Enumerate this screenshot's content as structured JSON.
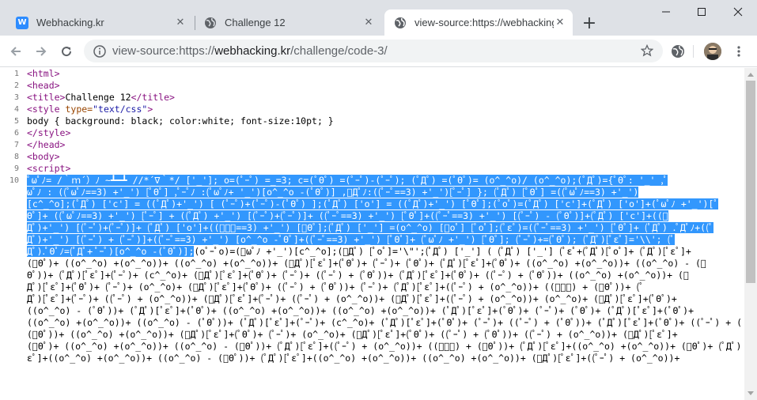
{
  "browser": {
    "tabs": [
      {
        "title": "Webhacking.kr",
        "favicon": "w-logo-icon",
        "active": false
      },
      {
        "title": "Challenge 12",
        "favicon": "globe-icon",
        "active": false
      },
      {
        "title": "view-source:https://webhacking",
        "favicon": "globe-icon",
        "active": true
      }
    ],
    "close_glyph": "✕",
    "new_tab_glyph": "+",
    "address": {
      "scheme": "view-source:https://",
      "host": "webhacking.kr",
      "path": "/challenge/code-3/"
    }
  },
  "source": {
    "lines": [
      {
        "num": "1",
        "open": "<html>"
      },
      {
        "num": "2",
        "open": "<head>"
      },
      {
        "num": "3",
        "open": "<title>",
        "text": "Challenge 12",
        "close": "</title>"
      },
      {
        "num": "4",
        "tagstart": "<style ",
        "attrname": "type=",
        "attrval": "\"text/css\"",
        "tagend": ">"
      },
      {
        "num": "5",
        "text": "body { background: black; color:white; font-size:10pt; }"
      },
      {
        "num": "6",
        "open": "</style>"
      },
      {
        "num": "7",
        "open": "</head>"
      },
      {
        "num": "8",
        "open": "<body>"
      },
      {
        "num": "9",
        "open": "<script>"
      },
      {
        "num": "10"
      }
    ],
    "line10_wrapped": [
      {
        "sel": "ﾟωﾟﾉ= /｀ｍ´）ﾉ ~┻━┻   //*´∇｀*/ ['_']; o=(ﾟｰﾟ)  =_=3; c=(ﾟΘﾟ) =(ﾟｰﾟ)-(ﾟｰﾟ); (ﾟДﾟ) =(ﾟΘﾟ)= (o^_^o)/ (o^_^o);(ﾟДﾟ)={ﾟΘﾟ: '_' ,ﾟ",
        "rest": ""
      },
      {
        "sel": "ωﾟﾉ : ((ﾟωﾟﾉ==3) +'_') [ﾟΘﾟ] ,ﾟｰﾟﾉ :(ﾟωﾟﾉ+ '_')[o^_^o -(ﾟΘﾟ)] ,ﾟДﾟﾉ:((ﾟｰﾟ==3) +'_')[ﾟｰﾟ] }; (ﾟДﾟ) [ﾟΘﾟ] =((ﾟωﾟﾉ==3) +'_')",
        "rest": ""
      },
      {
        "sel": "[c^_^o];(ﾟДﾟ) ['c'] = ((ﾟДﾟ)+'_') [ (ﾟｰﾟ)+(ﾟｰﾟ)-(ﾟΘﾟ) ];(ﾟДﾟ) ['o'] = ((ﾟДﾟ)+'_') [ﾟΘﾟ];(ﾟoﾟ)=(ﾟДﾟ) ['c']+(ﾟДﾟ) ['o']+(ﾟωﾟﾉ +'_')[ﾟ",
        "rest": ""
      },
      {
        "sel": "Θﾟ]+ ((ﾟωﾟﾉ==3) +'_') [ﾟｰﾟ] + ((ﾟДﾟ) +'_') [(ﾟｰﾟ)+(ﾟｰﾟ)]+ ((ﾟｰﾟ==3) +'_') [ﾟΘﾟ]+((ﾟｰﾟ==3) +'_') [(ﾟｰﾟ) - (ﾟΘﾟ)]+(ﾟДﾟ) ['c']+((ﾟ",
        "rest": ""
      },
      {
        "sel": "Дﾟ)+'_') [(ﾟｰﾟ)+(ﾟｰﾟ)]+ (ﾟДﾟ) ['o']+((ﾟｰﾟ==3) +'_') [ﾟΘﾟ];(ﾟДﾟ) ['_'] =(o^_^o) [ﾟoﾟ] [ﾟoﾟ];(ﾟεﾟ)=((ﾟｰﾟ==3) +'_') [ﾟΘﾟ]+ (ﾟДﾟ) .ﾟДﾟﾉ+((ﾟ",
        "rest": ""
      },
      {
        "sel": "Дﾟ)+'_') [(ﾟｰﾟ) + (ﾟｰﾟ)]+((ﾟｰﾟ==3) +'_') [o^_^o -ﾟΘﾟ]+((ﾟｰﾟ==3) +'_') [ﾟΘﾟ]+ (ﾟωﾟﾉ +'_') [ﾟΘﾟ]; (ﾟｰﾟ)+=(ﾟΘﾟ); (ﾟДﾟ)[ﾟεﾟ]='\\\\'; (ﾟ",
        "rest": ""
      },
      {
        "sel": "Дﾟ).ﾟΘﾟﾉ=(ﾟДﾟ+ ﾟｰﾟ)[o^_^o -(ﾟΘﾟ)];",
        "rest": "(oﾟｰﾟo)=(ﾟωﾟﾉ +'_')[c^_^o];(ﾟДﾟ) [ﾟoﾟ]='\\\"';(ﾟДﾟ) ['_'] ( (ﾟДﾟ) ['_'] (ﾟεﾟ+(ﾟДﾟ)[ﾟoﾟ]+ (ﾟДﾟ)[ﾟεﾟ]+"
      },
      {
        "sel": "",
        "rest": "(ﾟΘﾟ)+ ((o^_^o) +(o^_^o))+ ((o^_^o) +(o^_^o))+ (ﾟДﾟ)[ﾟεﾟ]+(ﾟΘﾟ)+ (ﾟｰﾟ)+ (ﾟΘﾟ)+ (ﾟДﾟ)[ﾟεﾟ]+(ﾟΘﾟ)+ ((o^_^o) +(o^_^o))+ ((o^_^o) - (ﾟ"
      },
      {
        "sel": "",
        "rest": "Θﾟ))+ (ﾟДﾟ)[ﾟεﾟ]+(ﾟｰﾟ)+ (c^_^o)+ (ﾟДﾟ)[ﾟεﾟ]+(ﾟΘﾟ)+ (ﾟｰﾟ)+ ((ﾟｰﾟ) + (ﾟΘﾟ))+ (ﾟДﾟ)[ﾟεﾟ]+(ﾟΘﾟ)+ ((ﾟｰﾟ) + (ﾟΘﾟ))+ ((o^_^o) +(o^_^o))+ (ﾟ"
      },
      {
        "sel": "",
        "rest": "Дﾟ)[ﾟεﾟ]+(ﾟΘﾟ)+ (ﾟｰﾟ)+ (o^_^o)+ (ﾟДﾟ)[ﾟεﾟ]+(ﾟΘﾟ)+ ((ﾟｰﾟ) + (ﾟΘﾟ))+ (ﾟｰﾟ)+ (ﾟДﾟ)[ﾟεﾟ]+((ﾟｰﾟ) + (o^_^o))+ ((ﾟｰﾟ) + (ﾟΘﾟ))+ (ﾟ"
      },
      {
        "sel": "",
        "rest": "Дﾟ)[ﾟεﾟ]+(ﾟｰﾟ)+ ((ﾟｰﾟ) + (o^_^o))+ (ﾟДﾟ)[ﾟεﾟ]+(ﾟｰﾟ)+ ((ﾟｰﾟ) + (o^_^o))+ (ﾟДﾟ)[ﾟεﾟ]+((ﾟｰﾟ) + (o^_^o))+ (o^_^o)+ (ﾟДﾟ)[ﾟεﾟ]+(ﾟΘﾟ)+"
      },
      {
        "sel": "",
        "rest": "((o^_^o) - (ﾟΘﾟ))+ (ﾟДﾟ)[ﾟεﾟ]+(ﾟΘﾟ)+ ((o^_^o) +(o^_^o))+ ((o^_^o) +(o^_^o))+ (ﾟДﾟ)[ﾟεﾟ]+(ﾟΘﾟ)+ (ﾟｰﾟ)+ (ﾟΘﾟ)+ (ﾟДﾟ)[ﾟεﾟ]+(ﾟΘﾟ)+"
      },
      {
        "sel": "",
        "rest": "((o^_^o) +(o^_^o))+ ((o^_^o) - (ﾟΘﾟ))+ (ﾟДﾟ)[ﾟεﾟ]+(ﾟｰﾟ)+ (c^_^o)+ (ﾟДﾟ)[ﾟεﾟ]+(ﾟΘﾟ)+ (ﾟｰﾟ)+ ((ﾟｰﾟ) + (ﾟΘﾟ))+ (ﾟДﾟ)[ﾟεﾟ]+(ﾟΘﾟ)+ ((ﾟｰﾟ) + (ﾟ"
      },
      {
        "sel": "",
        "rest": "(ﾟΘﾟ))+ ((o^_^o) +(o^_^o))+ (ﾟДﾟ)[ﾟεﾟ]+(ﾟΘﾟ)+ (ﾟｰﾟ)+ (o^_^o)+ (ﾟДﾟ)[ﾟεﾟ]+(ﾟΘﾟ)+ ((ﾟｰﾟ) + (ﾟΘﾟ))+ ((ﾟｰﾟ) + (o^_^o))+ (ﾟДﾟ)[ﾟεﾟ]+"
      },
      {
        "sel": "",
        "rest": "(ﾟΘﾟ)+ ((o^_^o) +(o^_^o))+ ((o^_^o) - (ﾟΘﾟ))+ (ﾟДﾟ)[ﾟεﾟ]+((ﾟｰﾟ) + (o^_^o))+ ((ﾟｰﾟ) + (ﾟΘﾟ))+ (ﾟДﾟ)[ﾟεﾟ]+((o^_^o) +(o^_^o))+ (ﾟΘﾟ)+ (ﾟДﾟ)[ﾟ"
      },
      {
        "sel": "",
        "rest": "εﾟ]+((o^_^o) +(o^_^o))+ ((o^_^o) - (ﾟΘﾟ))+ (ﾟДﾟ)[ﾟεﾟ]+((o^_^o) +(o^_^o))+ ((o^_^o) +(o^_^o))+ (ﾟДﾟ)[ﾟεﾟ]+((ﾟｰﾟ) + (o^_^o))+"
      }
    ]
  },
  "colors": {
    "tab_strip": "#dee1e6",
    "selection": "#3297fd",
    "tag": "#881280",
    "attr_name": "#994500",
    "attr_value": "#1a1aa6"
  }
}
